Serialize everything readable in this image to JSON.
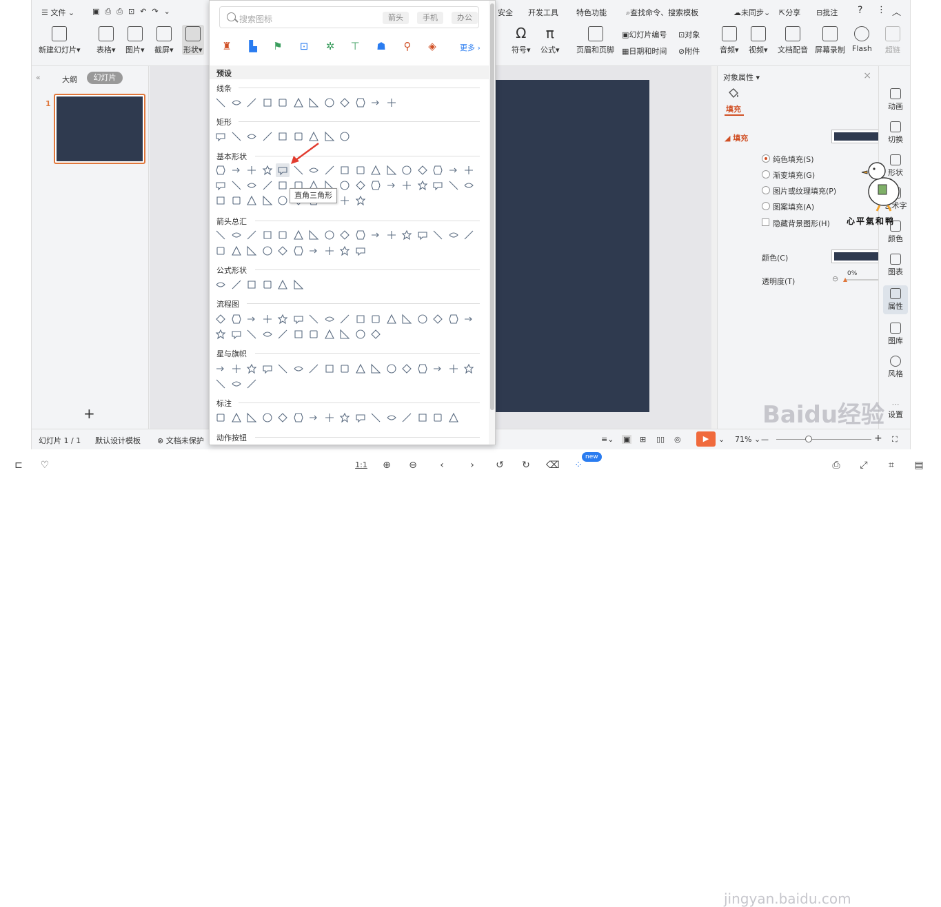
{
  "topbar": {
    "file": "文件",
    "dev_tools": "开发工具",
    "special": "特色功能",
    "search_cmd": "查找命令、搜索模板",
    "security": "安全",
    "unsynced": "未同步",
    "share": "分享",
    "comment": "批注"
  },
  "ribbon": {
    "new_slide": "新建幻灯片",
    "table": "表格",
    "picture": "图片",
    "screenshot": "截屏",
    "shape": "形状",
    "symbol": "符号",
    "formula": "公式",
    "header_footer": "页眉和页脚",
    "slide_number": "幻灯片编号",
    "object": "对象",
    "datetime": "日期和时间",
    "attachment": "附件",
    "audio": "音频",
    "video": "视频",
    "voiceover": "文档配音",
    "screen_record": "屏幕录制",
    "flash": "Flash",
    "hyperlink": "超链"
  },
  "left_pane": {
    "outline_tab": "大纲",
    "slides_tab": "幻灯片",
    "slide_number": "1",
    "add_icon": "+"
  },
  "shapes_panel": {
    "search_placeholder": "搜索图标",
    "chips": [
      "箭头",
      "手机",
      "办公"
    ],
    "more": "更多",
    "preset": "预设",
    "sections": {
      "lines": "线条",
      "rect": "矩形",
      "basic": "基本形状",
      "arrows": "箭头总汇",
      "formula": "公式形状",
      "flowchart": "流程图",
      "stars": "星与旗帜",
      "callouts": "标注",
      "actions": "动作按钮"
    },
    "tooltip": "直角三角形"
  },
  "right_pane": {
    "title": "对象属性",
    "fill_tab": "填充",
    "fill_header": "填充",
    "options": [
      "纯色填充(S)",
      "渐变填充(G)",
      "图片或纹理填充(P)",
      "图案填充(A)"
    ],
    "hide_bg": "隐藏背景图形(H)",
    "color_label": "颜色(C)",
    "transparency_label": "透明度(T)",
    "transparency_value": "0%",
    "fill_color": "#2f3a4f"
  },
  "right_tools": {
    "animation": "动画",
    "transition": "切换",
    "shape": "形状",
    "art": "艺术字",
    "color": "颜色",
    "chart": "图表",
    "properties": "属性",
    "gallery": "图库",
    "style": "风格",
    "settings": "设置"
  },
  "statusbar": {
    "slide_count": "幻灯片 1 / 1",
    "design": "默认设计模板",
    "unprotected": "文档未保护",
    "zoom": "71%"
  },
  "bottom_bar": {
    "ratio": "1:1",
    "new_badge": "new"
  },
  "watermark": {
    "brand": "心平氣和鸭",
    "main": "Baidu经验",
    "sub": "jingyan.baidu.com"
  }
}
